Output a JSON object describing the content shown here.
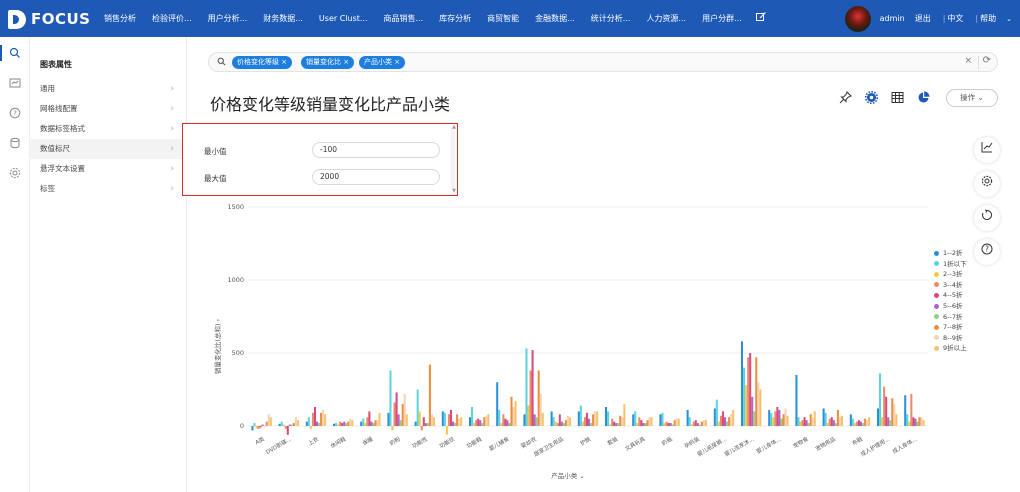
{
  "app": {
    "brand": "FOCUS",
    "nav": [
      "销售分析",
      "检验评价...",
      "用户分析...",
      "财务数据...",
      "User Clust...",
      "商品销售...",
      "库存分析",
      "商贸智能",
      "金融数据...",
      "统计分析...",
      "人力资源...",
      "用户分群..."
    ],
    "user": {
      "name": "admin",
      "logout": "退出",
      "lang": "中文",
      "help": "帮助"
    }
  },
  "panel": {
    "title": "图表属性",
    "items": [
      "通用",
      "网格线配置",
      "数据标签格式",
      "数值标尺",
      "悬浮文本设置",
      "标签"
    ]
  },
  "search": {
    "tags": [
      "价格变化等级",
      "销量变化比",
      "产品小类"
    ]
  },
  "main": {
    "title": "价格变化等级销量变化比产品小类",
    "op_button": "操作"
  },
  "popup": {
    "min_label": "最小值",
    "min_value": "-100",
    "max_label": "最大值",
    "max_value": "2000"
  },
  "colors": {
    "primary": "#1e59b6",
    "tag": "#1e7ee0",
    "highlight_border": "#e02828"
  },
  "chart_data": {
    "type": "bar",
    "ylabel": "销量变化比(总和)",
    "xlabel": "产品小类",
    "yticks": [
      0,
      500,
      1000,
      1500
    ],
    "ylim": [
      -100,
      1500
    ],
    "categories": [
      "A类",
      "DVD影碟...",
      "上衣",
      "休闲鞋",
      "保暖",
      "奶粉",
      "功能性",
      "功能饮",
      "功能鞋",
      "婴儿辅食",
      "婴幼衣",
      "居家卫生用品",
      "护肤",
      "套装",
      "文具玩具",
      "奶瓶",
      "孕妈装",
      "婴儿纸尿裤...",
      "婴儿洗发沐...",
      "婴儿身体...",
      "宠物食",
      "宠物用品",
      "布鞋",
      "成人护理用...",
      "成人身体..."
    ],
    "series": [
      {
        "name": "1--2折",
        "color": "#2a8fd4",
        "values": [
          -30,
          15,
          30,
          15,
          30,
          90,
          30,
          100,
          60,
          300,
          80,
          100,
          100,
          130,
          80,
          80,
          110,
          120,
          580,
          110,
          350,
          120,
          80,
          120,
          210
        ]
      },
      {
        "name": "1折以下",
        "color": "#5bd3e0",
        "values": [
          20,
          30,
          60,
          20,
          50,
          380,
          250,
          90,
          130,
          110,
          530,
          60,
          140,
          100,
          100,
          90,
          60,
          180,
          400,
          90,
          60,
          90,
          50,
          360,
          80
        ]
      },
      {
        "name": "2--3折",
        "color": "#f0cb4a",
        "values": [
          -15,
          10,
          -20,
          10,
          20,
          -30,
          100,
          -60,
          20,
          20,
          140,
          30,
          30,
          10,
          20,
          20,
          10,
          30,
          280,
          60,
          30,
          20,
          20,
          60,
          30
        ]
      },
      {
        "name": "3--4折",
        "color": "#e98c6c",
        "values": [
          -20,
          -20,
          90,
          30,
          60,
          160,
          -30,
          80,
          40,
          80,
          380,
          20,
          60,
          50,
          60,
          30,
          30,
          70,
          470,
          100,
          40,
          50,
          30,
          270,
          220
        ]
      },
      {
        "name": "4--5折",
        "color": "#d9497c",
        "values": [
          -10,
          -60,
          130,
          20,
          100,
          230,
          60,
          110,
          50,
          50,
          520,
          80,
          90,
          30,
          40,
          20,
          40,
          100,
          500,
          130,
          60,
          60,
          40,
          200,
          60
        ]
      },
      {
        "name": "5--6折",
        "color": "#b064c7",
        "values": [
          10,
          10,
          30,
          30,
          30,
          80,
          20,
          30,
          40,
          40,
          80,
          30,
          50,
          20,
          20,
          20,
          20,
          60,
          200,
          110,
          40,
          40,
          30,
          60,
          50
        ]
      },
      {
        "name": "6--7折",
        "color": "#8fd283",
        "values": [
          0,
          10,
          20,
          20,
          20,
          40,
          20,
          20,
          20,
          20,
          60,
          20,
          20,
          20,
          20,
          10,
          10,
          30,
          100,
          50,
          20,
          20,
          20,
          40,
          30
        ]
      },
      {
        "name": "7--8折",
        "color": "#f08b3c",
        "values": [
          30,
          20,
          90,
          30,
          40,
          150,
          420,
          80,
          60,
          200,
          380,
          40,
          80,
          70,
          40,
          40,
          30,
          60,
          470,
          80,
          80,
          110,
          50,
          190,
          60
        ]
      },
      {
        "name": "8--9折",
        "color": "#f3d3b7",
        "values": [
          80,
          60,
          110,
          50,
          40,
          220,
          80,
          50,
          70,
          130,
          220,
          70,
          100,
          60,
          60,
          50,
          40,
          80,
          300,
          120,
          60,
          60,
          40,
          150,
          60
        ]
      },
      {
        "name": "9折以上",
        "color": "#f5c46a",
        "values": [
          60,
          40,
          80,
          40,
          90,
          80,
          60,
          60,
          80,
          170,
          90,
          60,
          100,
          150,
          60,
          50,
          40,
          110,
          250,
          70,
          100,
          70,
          60,
          80,
          40
        ]
      }
    ]
  }
}
